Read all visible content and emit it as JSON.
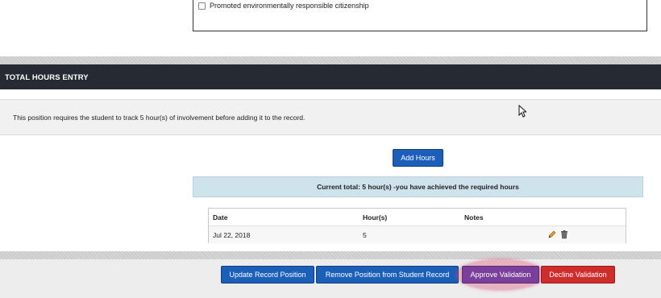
{
  "outcomes": {
    "checkbox_label": "Promoted environmentally responsible citizenship"
  },
  "section": {
    "title": "TOTAL HOURS ENTRY"
  },
  "info": {
    "text": "This position requires the student to track 5 hour(s) of involvement before adding it to the record."
  },
  "add_hours_label": "Add Hours",
  "current_total": "Current total: 5 hour(s) -you have achieved the required hours",
  "table": {
    "headers": {
      "date": "Date",
      "hours": "Hour(s)",
      "notes": "Notes"
    },
    "rows": [
      {
        "date": "Jul 22, 2018",
        "hours": "5",
        "notes": ""
      }
    ]
  },
  "actions": {
    "update": "Update Record Position",
    "remove": "Remove Position from Student Record",
    "approve": "Approve Validation",
    "decline": "Decline Validation"
  },
  "icons": {
    "edit": "pencil-icon",
    "delete": "trash-icon",
    "cursor": "mouse-pointer-icon"
  },
  "colors": {
    "header_bg": "#262b33",
    "primary_button": "#1b5fb8",
    "approve_button": "#7a3f9a",
    "decline_button": "#cf2c2c",
    "total_bg": "#cfe3ec",
    "highlight": "#de466e"
  }
}
